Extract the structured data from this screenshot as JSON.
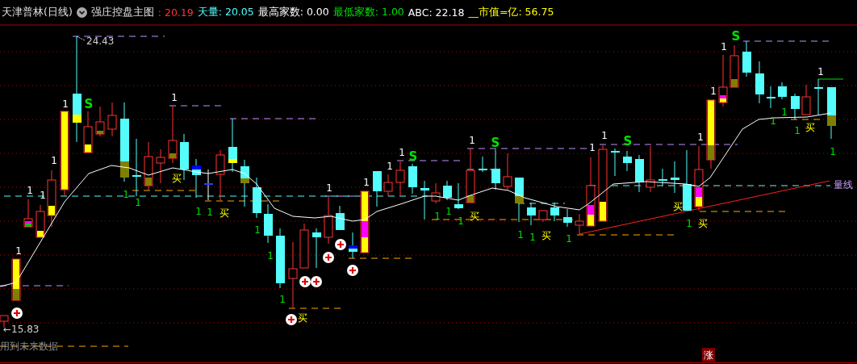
{
  "header": {
    "stock": "天津普林(日线)",
    "indicator": "强庄控盘主图",
    "readouts": [
      {
        "text": ": 20.19",
        "color": "#ff3232"
      },
      {
        "text": "天量: 20.05",
        "color": "#54fcfc"
      },
      {
        "text": "最高家数: 0.00",
        "color": "#ffffff"
      },
      {
        "text": "最低家数: 1.00",
        "color": "#00e000"
      },
      {
        "text": "ABC: 22.18",
        "color": "#ffffff"
      },
      {
        "text": "__市值=亿: 56.75",
        "color": "#ffff00"
      }
    ]
  },
  "chart": {
    "price_labels": [
      "24.43",
      "←15.83"
    ],
    "line_label": "量线",
    "note": "用到未来数据",
    "badge": "涨",
    "markers": [
      {
        "text": "1",
        "kind": "count"
      },
      {
        "text": "1",
        "kind": "count"
      },
      {
        "text": "1",
        "kind": "count"
      },
      {
        "text": "1",
        "kind": "count"
      },
      {
        "text": "1",
        "kind": "count"
      },
      {
        "text": "1",
        "kind": "count"
      },
      {
        "text": "1",
        "kind": "count"
      },
      {
        "text": "1",
        "kind": "count"
      },
      {
        "text": "1",
        "kind": "count"
      },
      {
        "text": "1",
        "kind": "count"
      },
      {
        "text": "1",
        "kind": "count"
      },
      {
        "text": "1",
        "kind": "count"
      },
      {
        "text": "1",
        "kind": "count"
      },
      {
        "text": "1",
        "kind": "count"
      },
      {
        "text": "1",
        "kind": "count"
      },
      {
        "text": "1",
        "kind": "count"
      },
      {
        "text": "1",
        "kind": "count"
      },
      {
        "text": "1",
        "kind": "low"
      },
      {
        "text": "1",
        "kind": "low"
      },
      {
        "text": "1",
        "kind": "low"
      },
      {
        "text": "1",
        "kind": "low"
      },
      {
        "text": "1",
        "kind": "low"
      },
      {
        "text": "1",
        "kind": "low"
      },
      {
        "text": "1",
        "kind": "low"
      },
      {
        "text": "1",
        "kind": "low"
      },
      {
        "text": "1",
        "kind": "low"
      },
      {
        "text": "1",
        "kind": "low"
      },
      {
        "text": "1",
        "kind": "low"
      },
      {
        "text": "1",
        "kind": "low"
      },
      {
        "text": "1",
        "kind": "low"
      },
      {
        "text": "1",
        "kind": "low"
      },
      {
        "text": "1",
        "kind": "low"
      },
      {
        "text": "1",
        "kind": "low"
      },
      {
        "text": "1",
        "kind": "low"
      },
      {
        "text": "1",
        "kind": "low"
      },
      {
        "text": "S",
        "kind": "sell"
      },
      {
        "text": "S",
        "kind": "sell"
      },
      {
        "text": "S",
        "kind": "sell"
      },
      {
        "text": "S",
        "kind": "sell"
      },
      {
        "text": "S",
        "kind": "sell"
      },
      {
        "text": "买",
        "kind": "buy"
      },
      {
        "text": "买",
        "kind": "buy"
      },
      {
        "text": "买",
        "kind": "buy"
      },
      {
        "text": "买",
        "kind": "buy"
      },
      {
        "text": "买",
        "kind": "buy"
      },
      {
        "text": "买",
        "kind": "buy"
      },
      {
        "text": "买",
        "kind": "buy"
      },
      {
        "text": "买",
        "kind": "buy"
      }
    ]
  }
}
